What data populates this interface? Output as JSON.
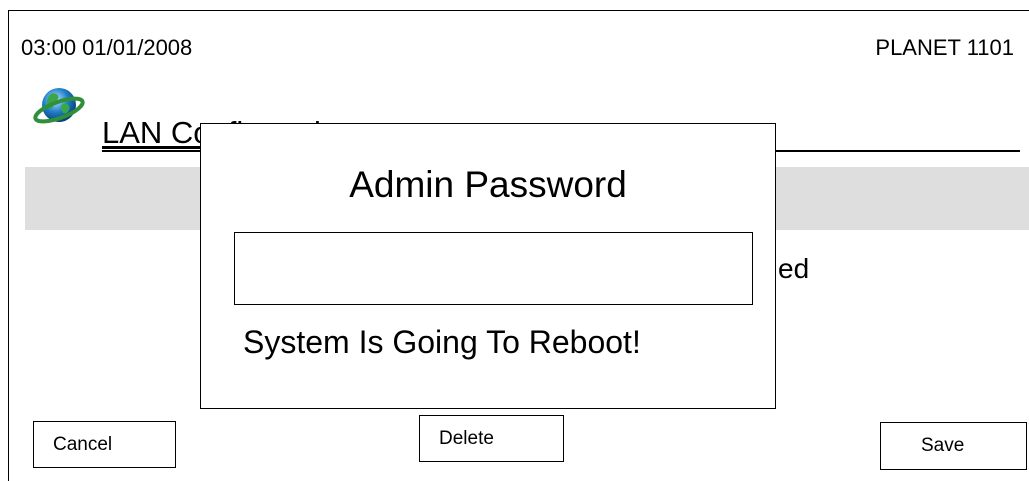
{
  "status_bar": {
    "datetime": "03:00 01/01/2008",
    "device_name": "PLANET 1101"
  },
  "header": {
    "icon": "globe-icon",
    "title": "LAN Configuration"
  },
  "background": {
    "partial_text": "ed"
  },
  "dialog": {
    "title": "Admin Password",
    "password_value": "",
    "message": "System Is Going To Reboot!"
  },
  "buttons": {
    "cancel": "Cancel",
    "delete": "Delete",
    "save": "Save"
  },
  "colors": {
    "band": "#dedede",
    "border": "#000000",
    "globe_blue": "#1e7fc9",
    "globe_green": "#3aa64a"
  }
}
